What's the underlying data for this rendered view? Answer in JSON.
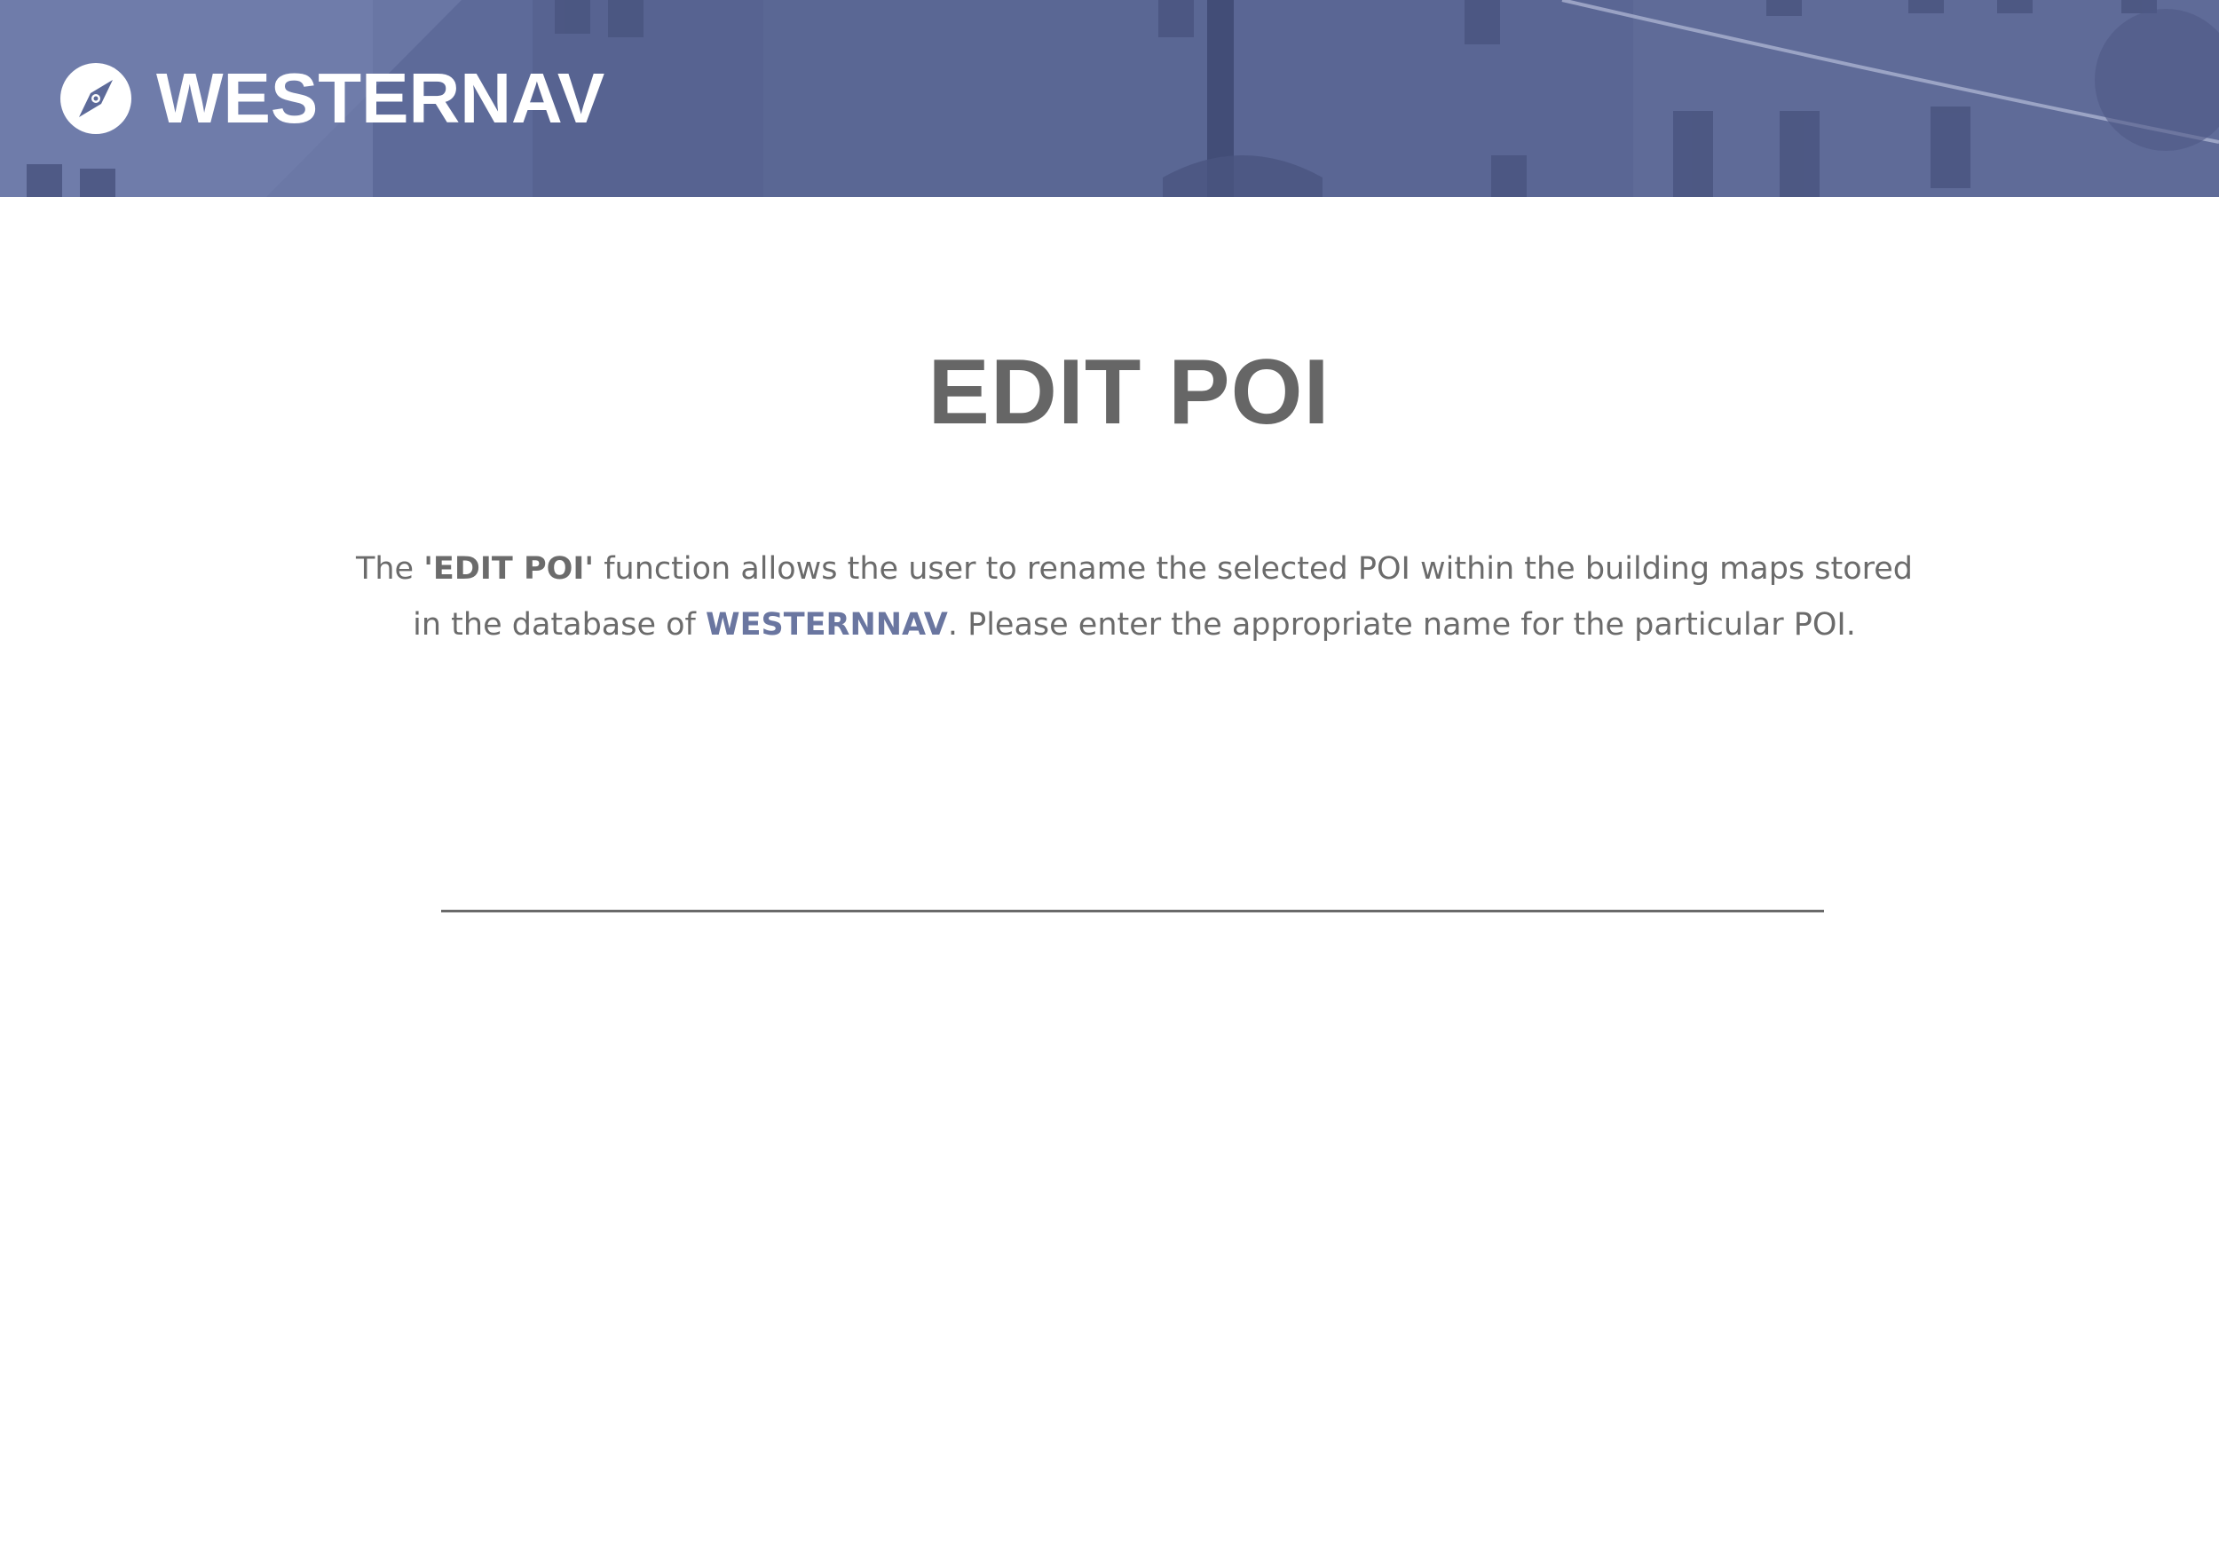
{
  "header": {
    "brand_name": "WESTERNAV",
    "logo_icon": "compass-icon",
    "banner_color": "#5d6a99"
  },
  "main": {
    "title": "EDIT POI",
    "description": {
      "part1": "The ",
      "highlight1": "'EDIT POI'",
      "part2": " function allows the user to rename the selected POI within the building maps stored in the database of ",
      "highlight2": "WESTERNNAV",
      "part3": ". Please enter the appropriate name for the particular POI."
    },
    "poi_name_input": {
      "value": "",
      "placeholder": ""
    }
  },
  "colors": {
    "text_gray": "#666666",
    "brand_accent": "#6a76a0",
    "white": "#ffffff"
  }
}
